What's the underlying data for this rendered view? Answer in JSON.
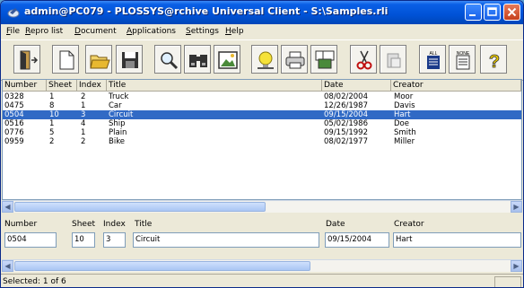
{
  "window": {
    "title": "admin@PC079 - PLOSSYS@rchive Universal Client - S:\\Samples.rli"
  },
  "menu": [
    {
      "label": "File",
      "accel": "F",
      "rest": "ile"
    },
    {
      "label": "Repro list",
      "accel": "R",
      "rest": "epro list"
    },
    {
      "label": "Document",
      "accel": "D",
      "rest": "ocument"
    },
    {
      "label": "Applications",
      "accel": "A",
      "rest": "pplications"
    },
    {
      "label": "Settings",
      "accel": "S",
      "rest": "ettings"
    },
    {
      "label": "Help",
      "accel": "H",
      "rest": "elp"
    }
  ],
  "toolbar": {
    "tools": [
      {
        "icon": "exit-door-icon"
      },
      {
        "icon": "new-document-icon"
      },
      {
        "icon": "open-folder-icon"
      },
      {
        "icon": "save-disk-icon"
      },
      {
        "icon": "magnifier-icon"
      },
      {
        "icon": "binoculars-icon"
      },
      {
        "icon": "image-view-icon"
      },
      {
        "icon": "lightbulb-icon"
      },
      {
        "icon": "print-icon"
      },
      {
        "icon": "document-stack-icon"
      },
      {
        "icon": "cut-scissors-icon"
      },
      {
        "icon": "paste-icon"
      },
      {
        "icon": "select-all-icon",
        "label": "ALL"
      },
      {
        "icon": "select-none-icon",
        "label": "NONE"
      },
      {
        "icon": "help-question-icon"
      }
    ]
  },
  "table": {
    "columns": [
      "Number",
      "Sheet",
      "Index",
      "Title",
      "Date",
      "Creator"
    ],
    "rows": [
      {
        "number": "0328",
        "sheet": "1",
        "index": "2",
        "title": "Truck",
        "date": "08/02/2004",
        "creator": "Moor",
        "selected": false
      },
      {
        "number": "0475",
        "sheet": "8",
        "index": "1",
        "title": "Car",
        "date": "12/26/1987",
        "creator": "Davis",
        "selected": false
      },
      {
        "number": "0504",
        "sheet": "10",
        "index": "3",
        "title": "Circuit",
        "date": "09/15/2004",
        "creator": "Hart",
        "selected": true
      },
      {
        "number": "0516",
        "sheet": "1",
        "index": "4",
        "title": "Ship",
        "date": "05/02/1986",
        "creator": "Doe",
        "selected": false
      },
      {
        "number": "0776",
        "sheet": "5",
        "index": "1",
        "title": "Plain",
        "date": "09/15/1992",
        "creator": "Smith",
        "selected": false
      },
      {
        "number": "0959",
        "sheet": "2",
        "index": "2",
        "title": "Bike",
        "date": "08/02/1977",
        "creator": "Miller",
        "selected": false
      }
    ]
  },
  "detail": {
    "labels": {
      "number": "Number",
      "sheet": "Sheet",
      "index": "Index",
      "title": "Title",
      "date": "Date",
      "creator": "Creator"
    },
    "values": {
      "number": "0504",
      "sheet": "10",
      "index": "3",
      "title": "Circuit",
      "date": "09/15/2004",
      "creator": "Hart"
    }
  },
  "status": {
    "text": "Selected: 1 of 6"
  },
  "colors": {
    "selection": "#316ac5",
    "titlebar": "#0052d6"
  }
}
